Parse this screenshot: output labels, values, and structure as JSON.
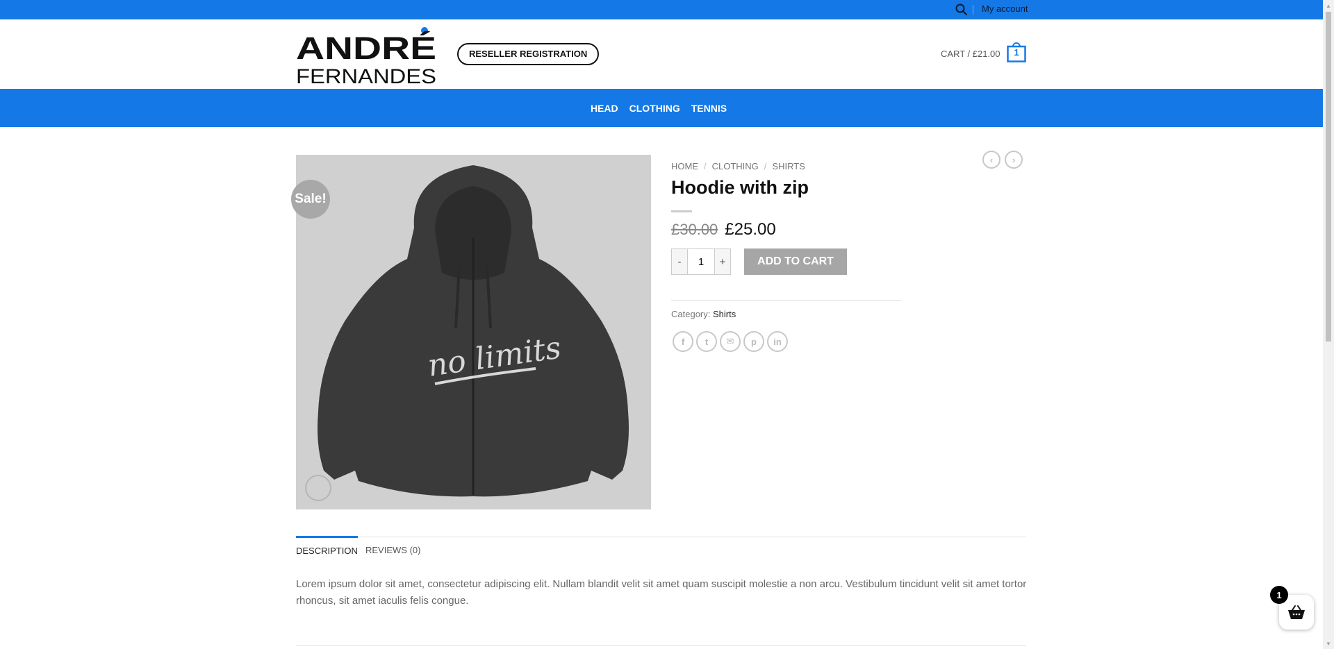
{
  "topbar": {
    "account_label": "My account"
  },
  "header": {
    "logo_line1": "ANDRÉ",
    "logo_line2": "FERNANDES",
    "reseller_label": "RESELLER REGISTRATION",
    "cart_label": "CART / £21.00",
    "cart_count": "1"
  },
  "nav": {
    "items": [
      {
        "label": "HEAD"
      },
      {
        "label": "CLOTHING"
      },
      {
        "label": "TENNIS"
      }
    ]
  },
  "product": {
    "sale_badge": "Sale!",
    "image_text": "no limits",
    "breadcrumb": [
      "HOME",
      "CLOTHING",
      "SHIRTS"
    ],
    "breadcrumb_separator": "/",
    "title": "Hoodie with zip",
    "old_price": "£30.00",
    "price": "£25.00",
    "qty_minus": "-",
    "qty_value": "1",
    "qty_plus": "+",
    "add_to_cart_label": "ADD TO CART",
    "category_label": "Category:",
    "category_value": "Shirts",
    "share_icons": [
      "facebook-icon",
      "twitter-icon",
      "email-icon",
      "pinterest-icon",
      "linkedin-icon"
    ]
  },
  "tabs": [
    {
      "label": "DESCRIPTION",
      "active": true
    },
    {
      "label": "REVIEWS (0)",
      "active": false
    }
  ],
  "description": "Lorem ipsum dolor sit amet, consectetur adipiscing elit. Nullam blandit velit sit amet quam suscipit molestie a non arcu. Vestibulum tincidunt velit sit amet tortor rhoncus, sit amet iaculis felis congue.",
  "basket_widget": {
    "count": "1"
  },
  "colors": {
    "accent": "#1479e6",
    "sale_badge": "#a8a8a8",
    "button_disabled": "#a6a6a6"
  }
}
